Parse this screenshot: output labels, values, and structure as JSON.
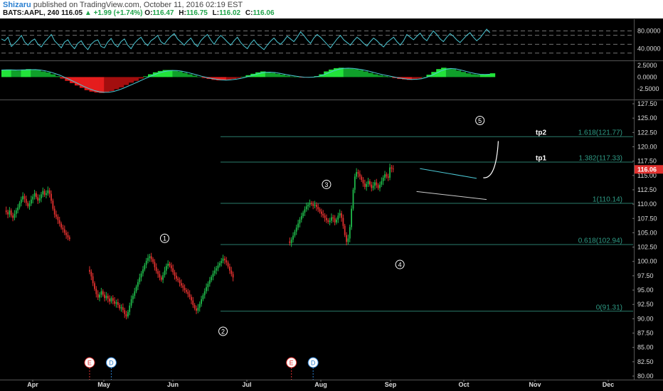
{
  "header": {
    "author": "Shizaru",
    "published_text": "published on TradingView.com, October 11, 2016 02:19 EST",
    "symbol": "BATS:AAPL, 240",
    "last": "116.05",
    "change_arrow": "▲",
    "change": "+1.99 (+1.74%)",
    "o_label": "O:",
    "o_value": "116.47",
    "h_label": "H:",
    "h_value": "116.75",
    "l_label": "L:",
    "l_value": "116.02",
    "c_label": "C:",
    "c_value": "116.06"
  },
  "colors": {
    "bull": "#1fb94a",
    "bear": "#e0302e",
    "rsi": "#4cc9d6",
    "fib": "#2a7c6c",
    "fib_text": "#2f9c86",
    "price_tag": "#e0302e",
    "macd_pos": "#22e33a",
    "macd_pos_dark": "#0fa02a",
    "macd_neg": "#e51d1d",
    "macd_neg_dark": "#a30e0e"
  },
  "chart_data": [
    {
      "type": "line",
      "name": "rsi-panel",
      "yticks": [
        "80.0000",
        "40.0000"
      ],
      "bands": [
        80,
        70,
        50,
        30
      ],
      "ylim": [
        20,
        100
      ],
      "values": [
        62,
        58,
        66,
        45,
        52,
        60,
        70,
        55,
        48,
        57,
        62,
        50,
        44,
        55,
        63,
        72,
        58,
        50,
        42,
        55,
        60,
        48,
        40,
        52,
        58,
        46,
        38,
        50,
        57,
        60,
        45,
        42,
        55,
        63,
        50,
        44,
        56,
        62,
        48,
        40,
        52,
        60,
        66,
        54,
        47,
        58,
        63,
        70,
        56,
        50,
        60,
        68,
        74,
        62,
        55,
        48,
        57,
        64,
        52,
        45,
        58,
        66,
        72,
        60,
        50,
        62,
        70,
        63,
        55,
        48,
        58,
        66,
        54,
        46,
        40,
        52,
        60,
        50,
        44,
        38,
        48,
        57,
        64,
        55,
        50,
        58,
        68,
        62,
        56,
        66,
        78,
        70,
        60,
        52,
        64,
        72,
        66,
        58,
        50,
        42,
        52,
        62,
        70,
        60,
        54,
        48,
        58,
        66,
        60,
        52,
        46,
        56,
        64,
        58,
        50,
        44,
        54,
        60,
        66,
        56,
        48,
        58,
        72,
        66,
        60,
        68,
        75,
        64,
        58,
        70,
        80,
        72,
        62,
        56,
        66,
        74,
        68,
        60,
        54,
        62,
        70,
        76,
        66,
        58,
        64,
        74,
        84,
        76
      ]
    },
    {
      "type": "bar",
      "name": "macd-panel",
      "yticks": [
        "2.5000",
        "0.0000",
        "-2.5000"
      ],
      "ylim": [
        -4.2,
        2.8
      ],
      "values": [
        1.5,
        1.6,
        1.5,
        1.4,
        1.6,
        1.7,
        1.6,
        1.5,
        1.2,
        1.0,
        0.6,
        0.2,
        -0.3,
        -0.8,
        -1.3,
        -1.8,
        -2.3,
        -2.8,
        -3.1,
        -3.3,
        -3.4,
        -3.3,
        -3.0,
        -2.6,
        -2.2,
        -1.7,
        -1.2,
        -0.8,
        -0.3,
        0.2,
        0.6,
        1.0,
        1.3,
        1.5,
        1.5,
        1.4,
        1.2,
        0.9,
        0.6,
        0.3,
        0.0,
        -0.2,
        -0.4,
        -0.6,
        -0.7,
        -0.7,
        -0.6,
        -0.4,
        -0.2,
        0.1,
        0.4,
        0.7,
        1.0,
        1.2,
        1.1,
        0.9,
        0.7,
        0.5,
        0.3,
        0.1,
        0.0,
        -0.1,
        -0.1,
        0.0,
        0.2,
        0.6,
        1.2,
        1.6,
        1.9,
        2.0,
        1.9,
        1.8,
        1.7,
        1.5,
        1.2,
        0.9,
        0.6,
        0.4,
        0.2,
        0.0,
        -0.2,
        -0.4,
        -0.5,
        -0.6,
        -0.5,
        -0.3,
        0.0,
        0.5,
        1.1,
        1.7,
        2.0,
        1.9,
        1.7,
        1.4,
        1.1,
        0.8,
        0.6,
        0.5,
        0.5,
        0.6,
        0.8
      ]
    },
    {
      "type": "candlestick",
      "name": "price-panel",
      "x_labels": [
        "Apr",
        "May",
        "Jun",
        "Jul",
        "Aug",
        "Sep",
        "Oct",
        "Nov",
        "Dec"
      ],
      "y_ticks": [
        "127.50",
        "125.00",
        "122.50",
        "120.00",
        "117.50",
        "115.00",
        "112.50",
        "110.00",
        "107.50",
        "105.00",
        "102.50",
        "100.00",
        "97.50",
        "95.00",
        "92.50",
        "90.00",
        "87.50",
        "85.00",
        "82.50",
        "80.00"
      ],
      "ylim": [
        80,
        127.5
      ],
      "last_price": "116.06",
      "fib_levels": [
        {
          "label": "1.618(121.77)",
          "tag": "tp2",
          "value": 121.77
        },
        {
          "label": "1.382(117.33)",
          "tag": "tp1",
          "value": 117.33
        },
        {
          "label": "1(110.14)",
          "tag": "",
          "value": 110.14
        },
        {
          "label": "0.618(102.94)",
          "tag": "",
          "value": 102.94
        },
        {
          "label": "0(91.31)",
          "tag": "",
          "value": 91.31
        }
      ],
      "waves": [
        {
          "label": "1",
          "date_index": 97,
          "price": 101.8
        },
        {
          "label": "2",
          "date_index": 132,
          "price": 89.8
        },
        {
          "label": "3",
          "date_index": 194,
          "price": 111.2
        },
        {
          "label": "4",
          "date_index": 238,
          "price": 101.2
        },
        {
          "label": "5",
          "date_index": 286,
          "price": 122.6
        }
      ],
      "event_markers": [
        {
          "label": "E",
          "date_index": 52,
          "kind": "earnings"
        },
        {
          "label": "D",
          "date_index": 65,
          "kind": "dividend"
        },
        {
          "label": "E",
          "date_index": 173,
          "kind": "earnings"
        },
        {
          "label": "D",
          "date_index": 186,
          "kind": "dividend"
        }
      ],
      "closes_segments": [
        {
          "start_index": 2,
          "closes": [
            108.6,
            108.2,
            108.9,
            108.0,
            107.6,
            108.3,
            108.9,
            109.4,
            110.2,
            110.8,
            111.4,
            110.9,
            110.2,
            109.6,
            110.1,
            110.8,
            111.3,
            111.9,
            111.2,
            110.6,
            111.0,
            111.7,
            112.3,
            111.6,
            111.9,
            112.4,
            111.8,
            110.6,
            109.2,
            108.2,
            107.8,
            107.2,
            106.6,
            105.9,
            105.6,
            105.0,
            104.6,
            104.2,
            103.9
          ]
        },
        {
          "start_index": 52,
          "closes": [
            98.2,
            97.4,
            96.2,
            95.2,
            94.3,
            93.7,
            94.2,
            94.8,
            94.2,
            93.6,
            94.0,
            93.5,
            93.0,
            93.6,
            93.1,
            92.6,
            92.9,
            92.4,
            91.8,
            92.0,
            91.5,
            90.8,
            90.4,
            91.2,
            92.3,
            93.4,
            94.0,
            94.8,
            95.6,
            96.4,
            97.2,
            97.9,
            98.6,
            99.4,
            100.1,
            100.6,
            100.9,
            100.4,
            99.9,
            99.0,
            98.3,
            97.8,
            97.2,
            96.8,
            97.6,
            98.4,
            99.2,
            99.6,
            99.3,
            98.8,
            98.1,
            97.5,
            97.0,
            96.7,
            96.2,
            95.8,
            95.4,
            95.0,
            94.7,
            94.3,
            93.8,
            93.2,
            92.4,
            91.8,
            91.4,
            91.9,
            92.6,
            93.4,
            94.1,
            94.8,
            95.5,
            96.1,
            96.7,
            97.3,
            97.9,
            98.4,
            98.8,
            99.3,
            99.7,
            100.1,
            100.5,
            100.2,
            99.8,
            99.1,
            98.4,
            97.8,
            97.2
          ]
        },
        {
          "start_index": 172,
          "closes": [
            103.2,
            103.8,
            104.5,
            105.2,
            105.9,
            106.6,
            107.3,
            107.9,
            108.5,
            109.1,
            109.6,
            109.9,
            110.2,
            110.0,
            109.7,
            109.9,
            109.5,
            109.1,
            108.7,
            108.3,
            108.0,
            107.6,
            107.2,
            106.9,
            107.1,
            107.7,
            107.5,
            106.8,
            107.3,
            108.0,
            108.4,
            107.6,
            106.2,
            104.6,
            103.4,
            104.0,
            106.0,
            109.2,
            112.5,
            114.8,
            115.6,
            115.3,
            114.8,
            114.2,
            113.6,
            113.0,
            113.5,
            114.0,
            113.4,
            112.8,
            113.2,
            113.8,
            113.3,
            112.8,
            113.4,
            114.0,
            114.6,
            115.2,
            114.8,
            114.6,
            116.4,
            116.2,
            116.06
          ]
        }
      ]
    }
  ]
}
